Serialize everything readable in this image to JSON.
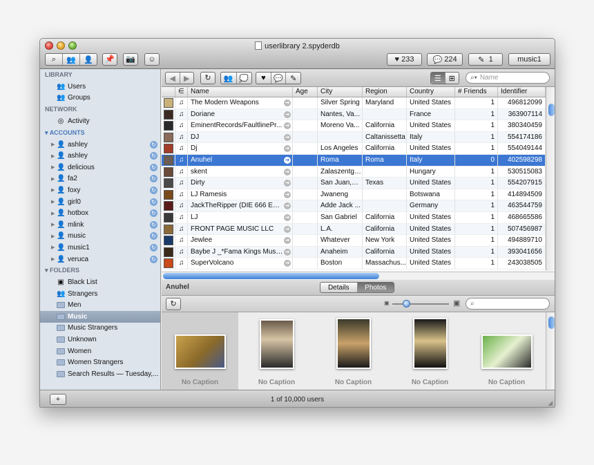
{
  "window": {
    "title": "userlibrary 2.spyderdb"
  },
  "toolbar": {
    "favorites_count": "233",
    "messages_count": "224",
    "notes_count": "1",
    "account": "music1"
  },
  "sidebar": {
    "library_heading": "LIBRARY",
    "library": [
      "Users",
      "Groups"
    ],
    "network_heading": "NETWORK",
    "network": [
      "Activity"
    ],
    "accounts_heading": "ACCOUNTS",
    "accounts": [
      "ashley",
      "ashley",
      "delicious",
      "fa2",
      "foxy",
      "girl0",
      "hotbox",
      "mlink",
      "music",
      "music1",
      "veruca"
    ],
    "folders_heading": "FOLDERS",
    "folders": [
      "Black List",
      "Strangers",
      "Men",
      "Music",
      "Music Strangers",
      "Unknown",
      "Women",
      "Women Strangers",
      "Search Results — Tuesday,..."
    ],
    "selected_folder": "Music"
  },
  "search": {
    "placeholder": "Name"
  },
  "table": {
    "columns": [
      "",
      "∈",
      "Name",
      "Age",
      "City",
      "Region",
      "Country",
      "# Friends",
      "Identifier"
    ],
    "rows": [
      {
        "name": "The Modern Weapons",
        "age": "",
        "city": "Silver Spring",
        "region": "Maryland",
        "country": "United States",
        "friends": "1",
        "id": "496812099"
      },
      {
        "name": "Doriane",
        "age": "",
        "city": "Nantes, Va...",
        "region": "",
        "country": "France",
        "friends": "1",
        "id": "363907114"
      },
      {
        "name": "EminentRecords/FaultlinePr...",
        "age": "",
        "city": "Moreno Va...",
        "region": "California",
        "country": "United States",
        "friends": "1",
        "id": "380340459"
      },
      {
        "name": "DJ",
        "age": "",
        "city": "",
        "region": "Caltanissetta",
        "country": "Italy",
        "friends": "1",
        "id": "554174186"
      },
      {
        "name": "Dj",
        "age": "",
        "city": "Los Angeles",
        "region": "California",
        "country": "United States",
        "friends": "1",
        "id": "554049144"
      },
      {
        "name": "Anuhel",
        "age": "",
        "city": "Roma",
        "region": "Roma",
        "country": "Italy",
        "friends": "0",
        "id": "402598298"
      },
      {
        "name": "skent",
        "age": "",
        "city": "Zalaszentgrót",
        "region": "",
        "country": "Hungary",
        "friends": "1",
        "id": "530515083"
      },
      {
        "name": "Dirty",
        "age": "",
        "city": "San Juan,W...",
        "region": "Texas",
        "country": "United States",
        "friends": "1",
        "id": "554207915"
      },
      {
        "name": "LJ Ramesis",
        "age": "",
        "city": "Jwaneng",
        "region": "",
        "country": "Botswana",
        "friends": "1",
        "id": "414894509"
      },
      {
        "name": "JackTheRipper (DIE 666 EP J...",
        "age": "",
        "city": "Adde Jack ...",
        "region": "",
        "country": "Germany",
        "friends": "1",
        "id": "463544759"
      },
      {
        "name": "LJ",
        "age": "",
        "city": "San Gabriel",
        "region": "California",
        "country": "United States",
        "friends": "1",
        "id": "468665586"
      },
      {
        "name": "FRONT PAGE MUSIC LLC",
        "age": "",
        "city": "L.A.",
        "region": "California",
        "country": "United States",
        "friends": "1",
        "id": "507456987"
      },
      {
        "name": "Jewlee",
        "age": "",
        "city": "Whatever",
        "region": "New York",
        "country": "United States",
        "friends": "1",
        "id": "494889710"
      },
      {
        "name": "Baybe J _*Fama Kings Music*_",
        "age": "",
        "city": "Anaheim",
        "region": "California",
        "country": "United States",
        "friends": "1",
        "id": "393041656"
      },
      {
        "name": "SuperVolcano",
        "age": "",
        "city": "Boston",
        "region": "Massachus...",
        "country": "United States",
        "friends": "1",
        "id": "243038505"
      }
    ],
    "selected_index": 5
  },
  "detail": {
    "selected_name": "Anuhel",
    "tabs": [
      "Details",
      "Photos"
    ],
    "active_tab": "Photos"
  },
  "photos": [
    {
      "caption": "No Caption"
    },
    {
      "caption": "No Caption"
    },
    {
      "caption": "No Caption"
    },
    {
      "caption": "No Caption"
    },
    {
      "caption": "No Caption"
    }
  ],
  "status": {
    "text": "1 of 10,000 users",
    "add_label": "+"
  },
  "colors": {
    "selection": "#3b77d3",
    "sidebar_bg": "#dde4ec",
    "folder_selection": "#8b9bb1"
  }
}
